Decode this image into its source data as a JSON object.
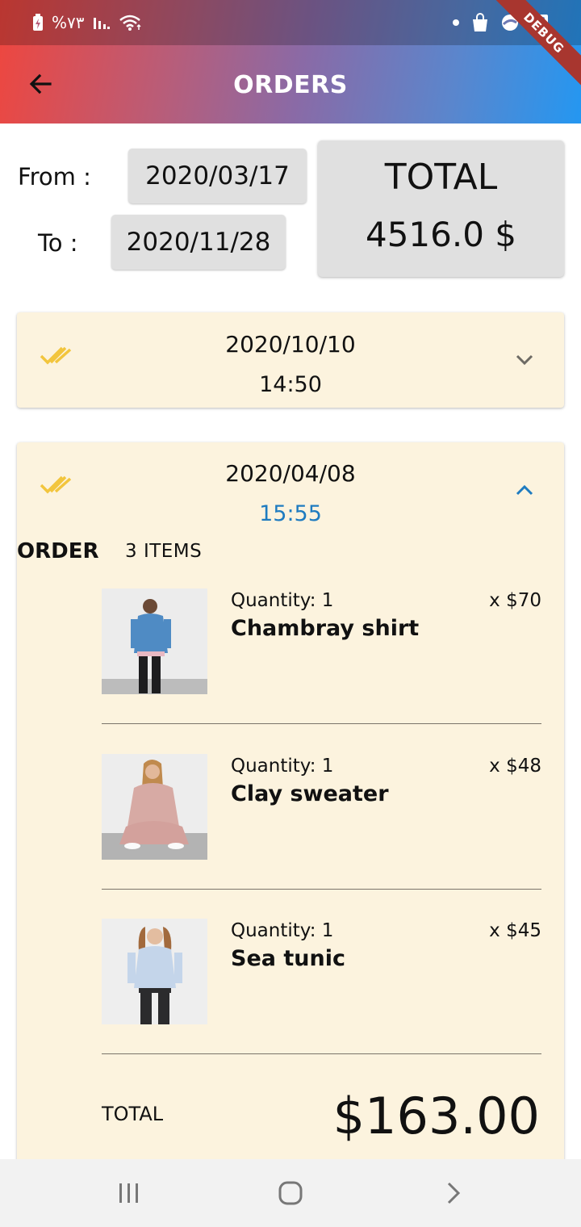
{
  "status_bar": {
    "battery_text": "%٧٣"
  },
  "app_bar": {
    "title": "ORDERS",
    "debug_label": "DEBUG"
  },
  "filter": {
    "from_label": "From :",
    "from_date": "2020/03/17",
    "to_label": "To :",
    "to_date": "2020/11/28",
    "total_title": "TOTAL",
    "total_value": "4516.0 $"
  },
  "orders": [
    {
      "date": "2020/10/10",
      "time": "14:50",
      "expanded": false
    },
    {
      "date": "2020/04/08",
      "time": "15:55",
      "expanded": true,
      "order_label": "ORDER",
      "items_count": "3 ITEMS",
      "items": [
        {
          "qty": "Quantity: 1",
          "name": "Chambray shirt",
          "price": "x $70",
          "image": "chambray-shirt-photo"
        },
        {
          "qty": "Quantity: 1",
          "name": "Clay sweater",
          "price": "x $48",
          "image": "clay-sweater-photo"
        },
        {
          "qty": "Quantity: 1",
          "name": "Sea tunic",
          "price": "x $45",
          "image": "sea-tunic-photo"
        }
      ],
      "total_label": "TOTAL",
      "total_value": "$163.00"
    }
  ],
  "colors": {
    "card_bg": "#fcf3de",
    "check_icon": "#f2c53d",
    "active_time": "#1e7bc0",
    "chip_bg": "#e0e0e0"
  }
}
